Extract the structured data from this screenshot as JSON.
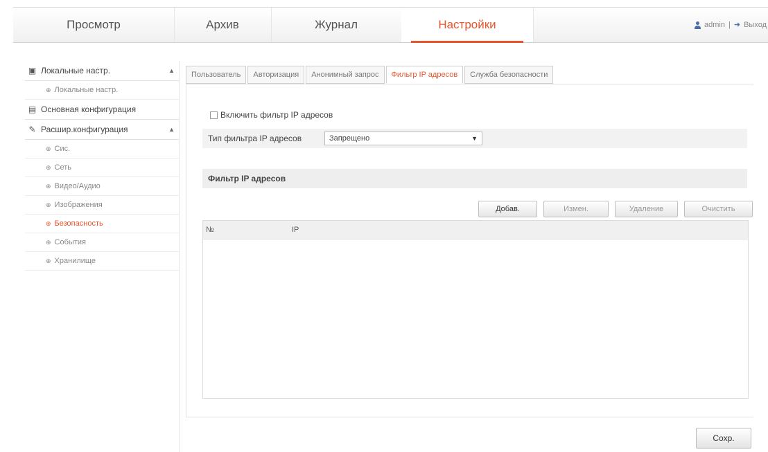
{
  "nav": {
    "tabs": [
      {
        "label": "Просмотр"
      },
      {
        "label": "Архив"
      },
      {
        "label": "Журнал"
      },
      {
        "label": "Настройки"
      }
    ],
    "user": "admin",
    "separator": "|",
    "logout": "Выход"
  },
  "sidebar": {
    "groups": [
      {
        "label": "Локальные настр.",
        "arrow": "▲",
        "items": [
          "Локальные настр."
        ]
      },
      {
        "label": "Основная конфигурация",
        "arrow": "",
        "items": []
      },
      {
        "label": "Расшир.конфигурация",
        "arrow": "▲",
        "items": [
          "Сис.",
          "Сеть",
          "Видео/Аудио",
          "Изображения",
          "Безопасность",
          "События",
          "Хранилище"
        ]
      }
    ]
  },
  "main": {
    "tabs": [
      "Пользователь",
      "Авторизация",
      "Анонимный запрос",
      "Фильтр IP адресов",
      "Служба безопасности"
    ],
    "enable_filter_label": "Включить фильтр IP адресов",
    "filter_type_label": "Тип фильтра IP адресов",
    "filter_type_value": "Запрещено",
    "section_title": "Фильтр IP адресов",
    "buttons": {
      "add": "Добав.",
      "edit": "Измен.",
      "delete": "Удаление",
      "clear": "Очистить"
    },
    "table_headers": [
      "№",
      "IP"
    ],
    "save": "Сохр."
  },
  "colors": {
    "accent": "#e8542c"
  }
}
